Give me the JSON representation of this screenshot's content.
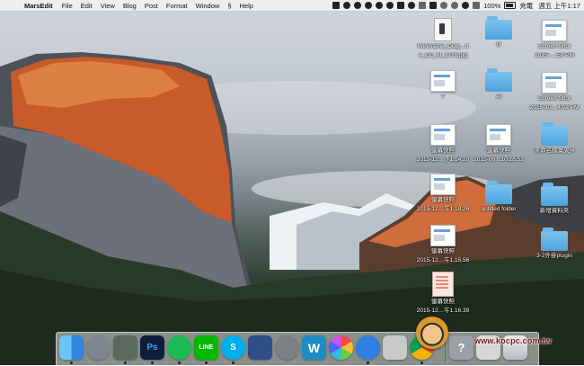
{
  "menubar": {
    "apple_symbol": "",
    "app_name": "MarsEdit",
    "menus": [
      "File",
      "Edit",
      "View",
      "Blog",
      "Post",
      "Format",
      "Window",
      "Help"
    ],
    "script_symbol": "§",
    "battery": "100%",
    "battery_badge": "充電",
    "clock": "週五 上午1:17"
  },
  "desktop_icons": [
    {
      "id": "wireframe-doc",
      "type": "doc",
      "label_1": "Wireframe_Diag…lt",
      "label_2": "e_CC_N_2.0.6.jpg"
    },
    {
      "id": "folder-a",
      "type": "folder",
      "label_1": "B",
      "label_2": ""
    },
    {
      "id": "screenshot-a",
      "type": "shot",
      "label_1": "Screen Shot",
      "label_2": "2015-…:50 PM"
    },
    {
      "id": "shot-t",
      "type": "shot",
      "label_1": "T",
      "label_2": ""
    },
    {
      "id": "folder-ai",
      "type": "folder",
      "label_1": "Ai",
      "label_2": ""
    },
    {
      "id": "screenshot-b",
      "type": "shot",
      "label_1": "Screen Shot",
      "label_2": "2015-10…4.02 PM"
    },
    {
      "id": "shot-1",
      "type": "shot",
      "label_1": "螢幕快照",
      "label_2": "2015-12…下1.14.20"
    },
    {
      "id": "shot-2",
      "type": "shot",
      "label_1": "螢幕快照",
      "label_2": "2015-06…10.28.52"
    },
    {
      "id": "folder-untitled-4",
      "type": "folder",
      "label_1": "未命名檔案夾 4",
      "label_2": ""
    },
    {
      "id": "shot-3",
      "type": "shot",
      "label_1": "螢幕快照",
      "label_2": "2015-12…午1.18.26"
    },
    {
      "id": "folder-untitled",
      "type": "folder",
      "label_1": "untitled folder",
      "label_2": ""
    },
    {
      "id": "folder-new",
      "type": "folder",
      "label_1": "新增資料夾",
      "label_2": ""
    },
    {
      "id": "shot-4",
      "type": "shot",
      "label_1": "螢幕快照",
      "label_2": "2015-12…午1.15.56"
    },
    {
      "id": "folder-plugin",
      "type": "folder",
      "label_1": "3-2外掛plugin",
      "label_2": ""
    },
    {
      "id": "form-doc",
      "type": "form",
      "label_1": "螢幕快照",
      "label_2": "2015-12…午1.16.39"
    }
  ],
  "dock": {
    "apps": [
      {
        "id": "finder",
        "label": "",
        "color": "#3b8fe2"
      },
      {
        "id": "launchpad",
        "label": "",
        "color": "#8a8f96"
      },
      {
        "id": "evernote",
        "label": "",
        "color": "#5d6a5f"
      },
      {
        "id": "photoshop",
        "label": "Ps",
        "color": "#0d1d3b"
      },
      {
        "id": "spotify",
        "label": "",
        "color": "#1db954"
      },
      {
        "id": "line",
        "label": "LINE",
        "color": "#00b900"
      },
      {
        "id": "skype",
        "label": "S",
        "color": "#00aff0"
      },
      {
        "id": "keynote",
        "label": "",
        "color": "#2f4d86"
      },
      {
        "id": "system-preferences",
        "label": "",
        "color": "#7b7f86"
      },
      {
        "id": "wordpress",
        "label": "W",
        "color": "#1e8cbe"
      },
      {
        "id": "photos",
        "label": "",
        "color": "#f3f3f3"
      },
      {
        "id": "safari",
        "label": "",
        "color": "#2f7fe0"
      },
      {
        "id": "rocket",
        "label": "",
        "color": "#c9c9c9"
      },
      {
        "id": "chrome",
        "label": "",
        "color": "#e8e8e8"
      },
      {
        "id": "help",
        "label": "?",
        "color": "#9aa0a6"
      },
      {
        "id": "preview",
        "label": "",
        "color": "#d7d7d7"
      },
      {
        "id": "trash",
        "label": "",
        "color": "#d5d8dc"
      }
    ]
  },
  "watermark": "www.kocpc.com.tw"
}
